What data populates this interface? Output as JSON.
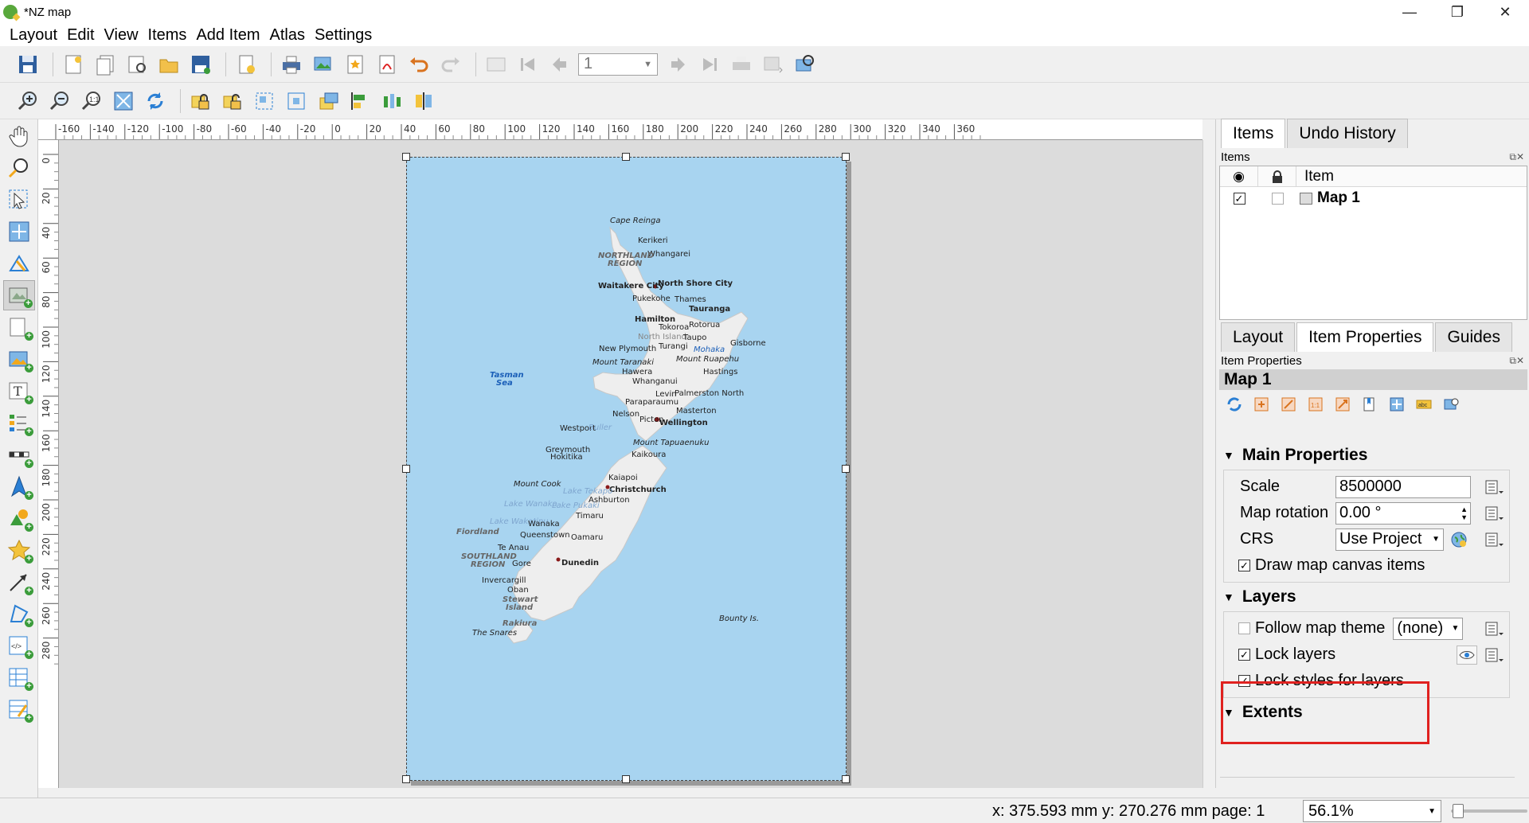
{
  "window": {
    "title": "*NZ map",
    "minimize": "—",
    "maximize": "❐",
    "close": "✕"
  },
  "menu": [
    "Layout",
    "Edit",
    "View",
    "Items",
    "Add Item",
    "Atlas",
    "Settings"
  ],
  "toolbar": {
    "page_number": "1"
  },
  "ruler": {
    "horizontal": [
      "-160",
      "-140",
      "-120",
      "-100",
      "-80",
      "-60",
      "-40",
      "-20",
      "0",
      "20",
      "40",
      "60",
      "80",
      "100",
      "120",
      "140",
      "160",
      "180",
      "200",
      "220",
      "240",
      "260",
      "280",
      "300",
      "320",
      "340",
      "360"
    ],
    "vertical": [
      "0",
      "20",
      "40",
      "60",
      "80",
      "100",
      "120",
      "140",
      "160",
      "180",
      "200",
      "220",
      "240",
      "260",
      "280"
    ]
  },
  "map": {
    "labels": {
      "cape_reinga": "Cape Reinga",
      "kerikeri": "Kerikeri",
      "whangarei": "Whangarei",
      "northland": "NORTHLAND",
      "northland_region": "REGION",
      "waitakere": "Waitakere City",
      "north_shore": "North Shore City",
      "pukekohe": "Pukekohe",
      "thames": "Thames",
      "tauranga": "Tauranga",
      "hamilton": "Hamilton",
      "tokoroa": "Tokoroa",
      "rotorua": "Rotorua",
      "north_island": "North Island",
      "taupo": "Taupo",
      "gisborne": "Gisborne",
      "turangi": "Turangi",
      "new_plymouth": "New Plymouth",
      "mohaka": "Mohaka",
      "mount_ruapehu": "Mount Ruapehu",
      "mount_taranaki": "Mount Taranaki",
      "hawera": "Hawera",
      "hastings": "Hastings",
      "tasman": "Tasman",
      "sea": "Sea",
      "whanganui": "Whanganui",
      "levin": "Levin",
      "palmerston_north": "Palmerston North",
      "paraparaumu": "Paraparaumu",
      "masterton": "Masterton",
      "nelson": "Nelson",
      "picton": "Picton",
      "wellington": "Wellington",
      "westport": "Westport",
      "buller": "Buller",
      "mount_tapuaenuku": "Mount Tapuaenuku",
      "greymouth": "Greymouth",
      "hokitika": "Hokitika",
      "kaikoura": "Kaikoura",
      "kaiapoi": "Kaiapoi",
      "mount_cook": "Mount Cook",
      "christchurch": "Christchurch",
      "ashburton": "Ashburton",
      "lake_tekapo": "Lake Tekapo",
      "lake_pukaki": "Lake Pukaki",
      "lake_wanaka": "Lake Wanaka",
      "timaru": "Timaru",
      "fiordland": "Fiordland",
      "lake_wakatipu": "Lake Wakatipu",
      "wanaka": "Wanaka",
      "queenstown": "Queenstown",
      "oamaru": "Oamaru",
      "te_anau": "Te Anau",
      "southland": "SOUTHLAND",
      "southland_region": "REGION",
      "gore": "Gore",
      "dunedin": "Dunedin",
      "invercargill": "Invercargill",
      "oban": "Oban",
      "stewart": "Stewart",
      "island": "Island",
      "rakiura": "Rakiura",
      "the_snares": "The Snares",
      "bounty": "Bounty Is."
    }
  },
  "right_panel": {
    "top_tabs": [
      "Items",
      "Undo History"
    ],
    "items_header": "Items",
    "item_col": "Item",
    "items": [
      {
        "name": "Map 1",
        "visible": true,
        "locked": false
      }
    ],
    "bottom_tabs": [
      "Layout",
      "Item Properties",
      "Guides"
    ],
    "item_props_header": "Item Properties",
    "item_title": "Map 1",
    "main_properties": {
      "heading": "Main Properties",
      "scale_label": "Scale",
      "scale_value": "8500000",
      "rotation_label": "Map rotation",
      "rotation_value": "0.00 °",
      "crs_label": "CRS",
      "crs_value": "Use Project",
      "draw_canvas_items": "Draw map canvas items"
    },
    "layers": {
      "heading": "Layers",
      "follow_theme": "Follow map theme",
      "theme_value": "(none)",
      "lock_layers": "Lock layers",
      "lock_styles": "Lock styles for layers"
    },
    "extents_heading": "Extents"
  },
  "status": {
    "coords": "x: 375.593 mm y: 270.276 mm page: 1",
    "zoom": "56.1%",
    "zoom_fraction": 0.03
  },
  "colors": {
    "sea": "#a8d4f0",
    "land": "#eeeeee",
    "highlight": "#e0211f"
  }
}
